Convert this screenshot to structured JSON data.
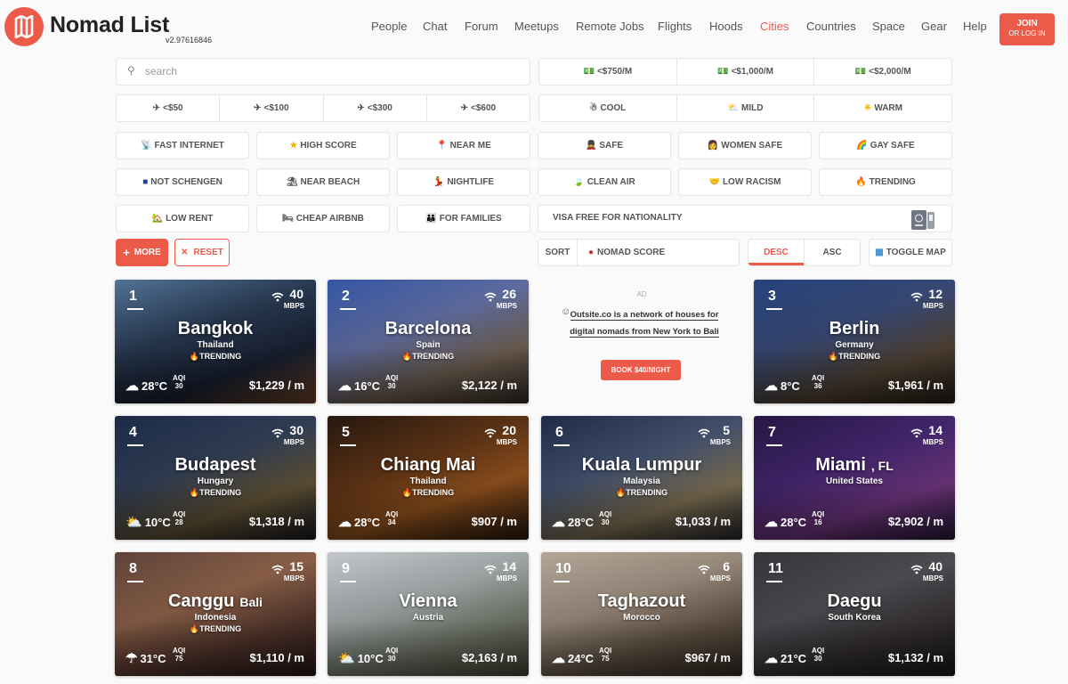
{
  "app": {
    "title": "Nomad List",
    "version": "v2.97616846"
  },
  "nav": [
    {
      "label": "People",
      "active": false
    },
    {
      "label": "Chat",
      "active": false
    },
    {
      "label": "Forum",
      "active": false
    },
    {
      "label": "Meetups",
      "active": false
    },
    {
      "label": "Remote Jobs",
      "active": false
    },
    {
      "label": "Flights",
      "active": false
    },
    {
      "label": "Hoods",
      "active": false
    },
    {
      "label": "Cities",
      "active": true
    },
    {
      "label": "Countries",
      "active": false
    },
    {
      "label": "Space",
      "active": false
    },
    {
      "label": "Gear",
      "active": false
    },
    {
      "label": "Help",
      "active": false
    }
  ],
  "join": {
    "line1": "JOIN",
    "line2": "OR LOG IN"
  },
  "search": {
    "placeholder": "search",
    "value": ""
  },
  "filters": {
    "budget": [
      {
        "icon": "money-icon",
        "label": "<$750/m"
      },
      {
        "icon": "money-icon",
        "label": "<$1,000/m"
      },
      {
        "icon": "money-icon",
        "label": "<$2,000/m"
      }
    ],
    "flights": [
      {
        "icon": "plane-icon",
        "label": "<$50"
      },
      {
        "icon": "plane-icon",
        "label": "<$100"
      },
      {
        "icon": "plane-icon",
        "label": "<$300"
      },
      {
        "icon": "plane-icon",
        "label": "<$600"
      }
    ],
    "climate": [
      {
        "icon": "snowman-icon",
        "label": "COOL"
      },
      {
        "icon": "sun-cloud-icon",
        "label": "MILD"
      },
      {
        "icon": "sun-icon",
        "label": "WARM"
      }
    ],
    "row3": [
      {
        "icon": "satellite-icon",
        "label": "FAST INTERNET"
      },
      {
        "icon": "star-icon",
        "label": "HIGH SCORE"
      },
      {
        "icon": "pin-icon",
        "label": "NEAR ME"
      },
      {
        "icon": "guard-icon",
        "label": "SAFE"
      },
      {
        "icon": "woman-icon",
        "label": "WOMEN SAFE"
      },
      {
        "icon": "rainbow-icon",
        "label": "GAY SAFE"
      }
    ],
    "row4": [
      {
        "icon": "eu-flag-icon",
        "label": "NOT SCHENGEN"
      },
      {
        "icon": "beach-icon",
        "label": "NEAR BEACH"
      },
      {
        "icon": "dancer-icon",
        "label": "NIGHTLIFE"
      },
      {
        "icon": "leaf-icon",
        "label": "CLEAN AIR"
      },
      {
        "icon": "hands-icon",
        "label": "LOW RACISM"
      },
      {
        "icon": "fire-icon",
        "label": "TRENDING"
      }
    ],
    "row5": [
      {
        "icon": "house-icon",
        "label": "LOW RENT"
      },
      {
        "icon": "bed-icon",
        "label": "CHEAP AIRBNB"
      },
      {
        "icon": "family-icon",
        "label": "FOR FAMILIES"
      }
    ],
    "visa": {
      "label": "VISA FREE FOR NATIONALITY"
    }
  },
  "actions": {
    "more": "MORE",
    "reset": "RESET"
  },
  "sort": {
    "label": "SORT",
    "value": "NOMAD SCORE",
    "desc": "DESC",
    "asc": "ASC",
    "toggle_map": "TOGGLE MAP"
  },
  "ad": {
    "tag": "AD",
    "text": "Outsite.co is a network of houses for digital nomads from New York to Bali",
    "button": "BOOK $40/NIGHT"
  },
  "cities": [
    {
      "rank": "1",
      "name": "Bangkok",
      "sub": "",
      "country": "Thailand",
      "trending": "TRENDING",
      "speed": "40",
      "mbps": "MBPS",
      "temp": "28°C",
      "aqi": "30",
      "weather": "cloud",
      "cost": "$1,229 / m"
    },
    {
      "rank": "2",
      "name": "Barcelona",
      "sub": "",
      "country": "Spain",
      "trending": "TRENDING",
      "speed": "26",
      "mbps": "MBPS",
      "temp": "16°C",
      "aqi": "30",
      "weather": "cloud",
      "cost": "$2,122 / m"
    },
    {
      "rank": "3",
      "name": "Berlin",
      "sub": "",
      "country": "Germany",
      "trending": "TRENDING",
      "speed": "12",
      "mbps": "MBPS",
      "temp": "8°C",
      "aqi": "36",
      "weather": "cloud",
      "cost": "$1,961 / m"
    },
    {
      "rank": "4",
      "name": "Budapest",
      "sub": "",
      "country": "Hungary",
      "trending": "TRENDING",
      "speed": "30",
      "mbps": "MBPS",
      "temp": "10°C",
      "aqi": "28",
      "weather": "sun-cloud",
      "cost": "$1,318 / m"
    },
    {
      "rank": "5",
      "name": "Chiang Mai",
      "sub": "",
      "country": "Thailand",
      "trending": "TRENDING",
      "speed": "20",
      "mbps": "MBPS",
      "temp": "28°C",
      "aqi": "34",
      "weather": "cloud",
      "cost": "$907 / m"
    },
    {
      "rank": "6",
      "name": "Kuala Lumpur",
      "sub": "",
      "country": "Malaysia",
      "trending": "TRENDING",
      "speed": "5",
      "mbps": "MBPS",
      "temp": "28°C",
      "aqi": "30",
      "weather": "cloud",
      "cost": "$1,033 / m"
    },
    {
      "rank": "7",
      "name": "Miami",
      "sub": ", FL",
      "country": "United States",
      "trending": "",
      "speed": "14",
      "mbps": "MBPS",
      "temp": "28°C",
      "aqi": "16",
      "weather": "cloud",
      "cost": "$2,902 / m"
    },
    {
      "rank": "8",
      "name": "Canggu",
      "sub": "Bali",
      "country": "Indonesia",
      "trending": "TRENDING",
      "speed": "15",
      "mbps": "MBPS",
      "temp": "31°C",
      "aqi": "75",
      "weather": "rain",
      "cost": "$1,110 / m"
    },
    {
      "rank": "9",
      "name": "Vienna",
      "sub": "",
      "country": "Austria",
      "trending": "",
      "speed": "14",
      "mbps": "MBPS",
      "temp": "10°C",
      "aqi": "30",
      "weather": "sun-cloud",
      "cost": "$2,163 / m"
    },
    {
      "rank": "10",
      "name": "Taghazout",
      "sub": "",
      "country": "Morocco",
      "trending": "",
      "speed": "6",
      "mbps": "MBPS",
      "temp": "24°C",
      "aqi": "75",
      "weather": "cloud",
      "cost": "$967 / m"
    },
    {
      "rank": "11",
      "name": "Daegu",
      "sub": "",
      "country": "South Korea",
      "trending": "",
      "speed": "40",
      "mbps": "MBPS",
      "temp": "21°C",
      "aqi": "30",
      "weather": "cloud",
      "cost": "$1,132 / m"
    }
  ],
  "colors": {
    "accent": "#ec5a4a",
    "text": "#555555",
    "border": "#e6e6e6"
  }
}
